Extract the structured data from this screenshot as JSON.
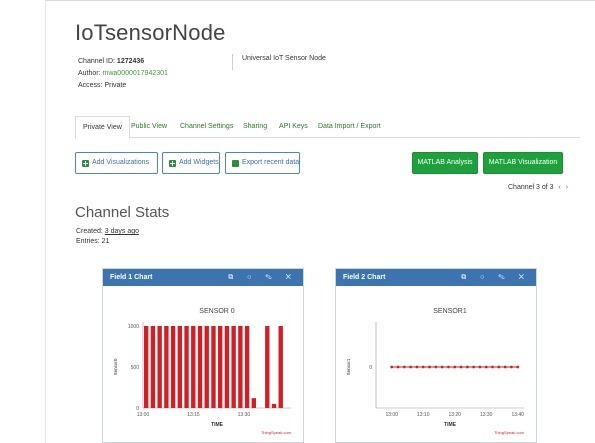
{
  "channel": {
    "title": "IoTsensorNode",
    "id_label": "Channel ID: ",
    "id_value": "1272436",
    "author_label": "Author: ",
    "author_value": "mwa0000017942301",
    "access": "Access: Private",
    "description": "Universal IoT Sensor Node"
  },
  "tabs": [
    "Private View",
    "Public View",
    "Channel Settings",
    "Sharing",
    "API Keys",
    "Data Import / Export"
  ],
  "toolbar": {
    "add_visualizations": "Add Visualizations",
    "add_widgets": "Add Widgets",
    "export": "Export recent data",
    "matlab_analysis": "MATLAB Analysis",
    "matlab_visualization": "MATLAB Visualization"
  },
  "pager": {
    "text": "Channel 3 of 3",
    "prev": "‹",
    "next": "›"
  },
  "stats": {
    "title": "Channel Stats",
    "created_label": "Created: ",
    "created_value": "3 days ago",
    "entries": "Entries: 21"
  },
  "panels": [
    {
      "title": "Field 1 Chart",
      "icons": [
        "external-link-icon",
        "comment-icon",
        "pencil-icon",
        "close-icon"
      ],
      "icon_glyphs": "⧉ ○ ✎ ✕"
    },
    {
      "title": "Field 2 Chart",
      "icons": [
        "external-link-icon",
        "comment-icon",
        "pencil-icon",
        "close-icon"
      ],
      "icon_glyphs": "⧉ ○ ✎ ✕"
    }
  ],
  "colors": {
    "accent_blue": "#3c74b0",
    "button_green": "#1ea03d",
    "series_red": "#d21f26"
  },
  "chart_data": [
    {
      "type": "bar",
      "title": "SENSOR 0",
      "xlabel": "TIME",
      "ylabel": "Sensor0",
      "ylim": [
        0,
        1000
      ],
      "yticks": [
        0,
        500,
        1000
      ],
      "xticks": [
        "13:00",
        "13:15",
        "13:30"
      ],
      "xlim_minutes": [
        0,
        44
      ],
      "credit": "ThingSpeak.com",
      "x_minutes": [
        0,
        2,
        4,
        6,
        8,
        10,
        12,
        14,
        16,
        18,
        20,
        22,
        24,
        26,
        28,
        30,
        32,
        34,
        36,
        38,
        40
      ],
      "values": [
        1000,
        1000,
        1000,
        1000,
        1000,
        1000,
        1000,
        1000,
        1000,
        1000,
        1000,
        1000,
        1000,
        1000,
        1000,
        1000,
        120,
        0,
        1000,
        50,
        1000
      ]
    },
    {
      "type": "line",
      "title": "SENSOR1",
      "xlabel": "TIME",
      "ylabel": "Sensor1",
      "ylim": [
        -1,
        1
      ],
      "yticks": [
        0
      ],
      "xticks": [
        "13:00",
        "13:10",
        "13:20",
        "13:30",
        "13:40"
      ],
      "xlim_minutes": [
        -5,
        42
      ],
      "credit": "ThingSpeak.com",
      "x_minutes": [
        0,
        2,
        4,
        6,
        8,
        10,
        12,
        14,
        16,
        18,
        20,
        22,
        24,
        26,
        28,
        30,
        32,
        34,
        36,
        38,
        40
      ],
      "values": [
        0,
        0,
        0,
        0,
        0,
        0,
        0,
        0,
        0,
        0,
        0,
        0,
        0,
        0,
        0,
        0,
        0,
        0,
        0,
        0,
        0
      ]
    }
  ]
}
